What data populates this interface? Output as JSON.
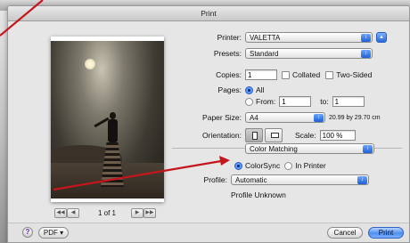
{
  "window": {
    "title": "Print"
  },
  "preview": {
    "page_count": "1 of 1"
  },
  "printer": {
    "label": "Printer:",
    "value": "VALETTA"
  },
  "presets": {
    "label": "Presets:",
    "value": "Standard"
  },
  "copies": {
    "label": "Copies:",
    "value": "1",
    "collated_label": "Collated",
    "two_sided_label": "Two-Sided"
  },
  "pages": {
    "label": "Pages:",
    "all_label": "All",
    "from_label": "From:",
    "from_value": "1",
    "to_label": "to:",
    "to_value": "1"
  },
  "paper_size": {
    "label": "Paper Size:",
    "value": "A4",
    "dimensions": "20.99 by 29.70 cm"
  },
  "orientation": {
    "label": "Orientation:",
    "scale_label": "Scale:",
    "scale_value": "100 %"
  },
  "section": {
    "value": "Color Matching"
  },
  "matching": {
    "colorsync_label": "ColorSync",
    "in_printer_label": "In Printer"
  },
  "profile": {
    "label": "Profile:",
    "value": "Automatic",
    "info": "Profile Unknown"
  },
  "footer": {
    "pdf_label": "PDF ▾",
    "cancel_label": "Cancel",
    "print_label": "Print",
    "help_glyph": "?"
  },
  "colors": {
    "annotation_red": "#c4161c",
    "accent_blue": "#2c5cbf"
  }
}
